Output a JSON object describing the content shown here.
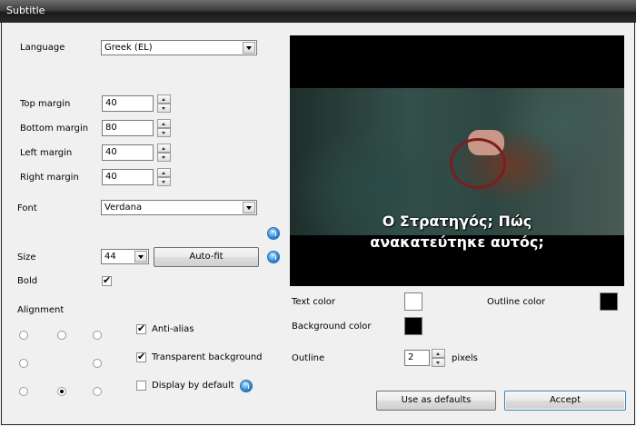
{
  "window": {
    "title": "Subtitle"
  },
  "language": {
    "label": "Language",
    "value": "Greek (EL)"
  },
  "margins": [
    {
      "label": "Top margin",
      "value": "40"
    },
    {
      "label": "Bottom margin",
      "value": "80"
    },
    {
      "label": "Left margin",
      "value": "40"
    },
    {
      "label": "Right margin",
      "value": "40"
    }
  ],
  "font": {
    "label": "Font",
    "value": "Verdana"
  },
  "size": {
    "label": "Size",
    "value": "44",
    "autofit_label": "Auto-fit"
  },
  "bold": {
    "label": "Bold",
    "checked": true
  },
  "alignment": {
    "label": "Alignment",
    "selected": "bottom-center"
  },
  "options": {
    "antialias": {
      "label": "Anti-alias",
      "checked": true
    },
    "transparent_bg": {
      "label": "Transparent background",
      "checked": true
    },
    "display_default": {
      "label": "Display by default",
      "checked": false
    }
  },
  "preview": {
    "subtitle_line1": "Ο Στρατηγός; Πώς",
    "subtitle_line2": "ανακατεύτηκε αυτός;"
  },
  "colors": {
    "text_color_label": "Text color",
    "text_color": "#ffffff",
    "outline_color_label": "Outline color",
    "outline_color": "#000000",
    "background_color_label": "Background color",
    "background_color": "#000000"
  },
  "outline": {
    "label": "Outline",
    "value": "2",
    "unit": "pixels"
  },
  "buttons": {
    "use_defaults": "Use as defaults",
    "accept": "Accept"
  }
}
